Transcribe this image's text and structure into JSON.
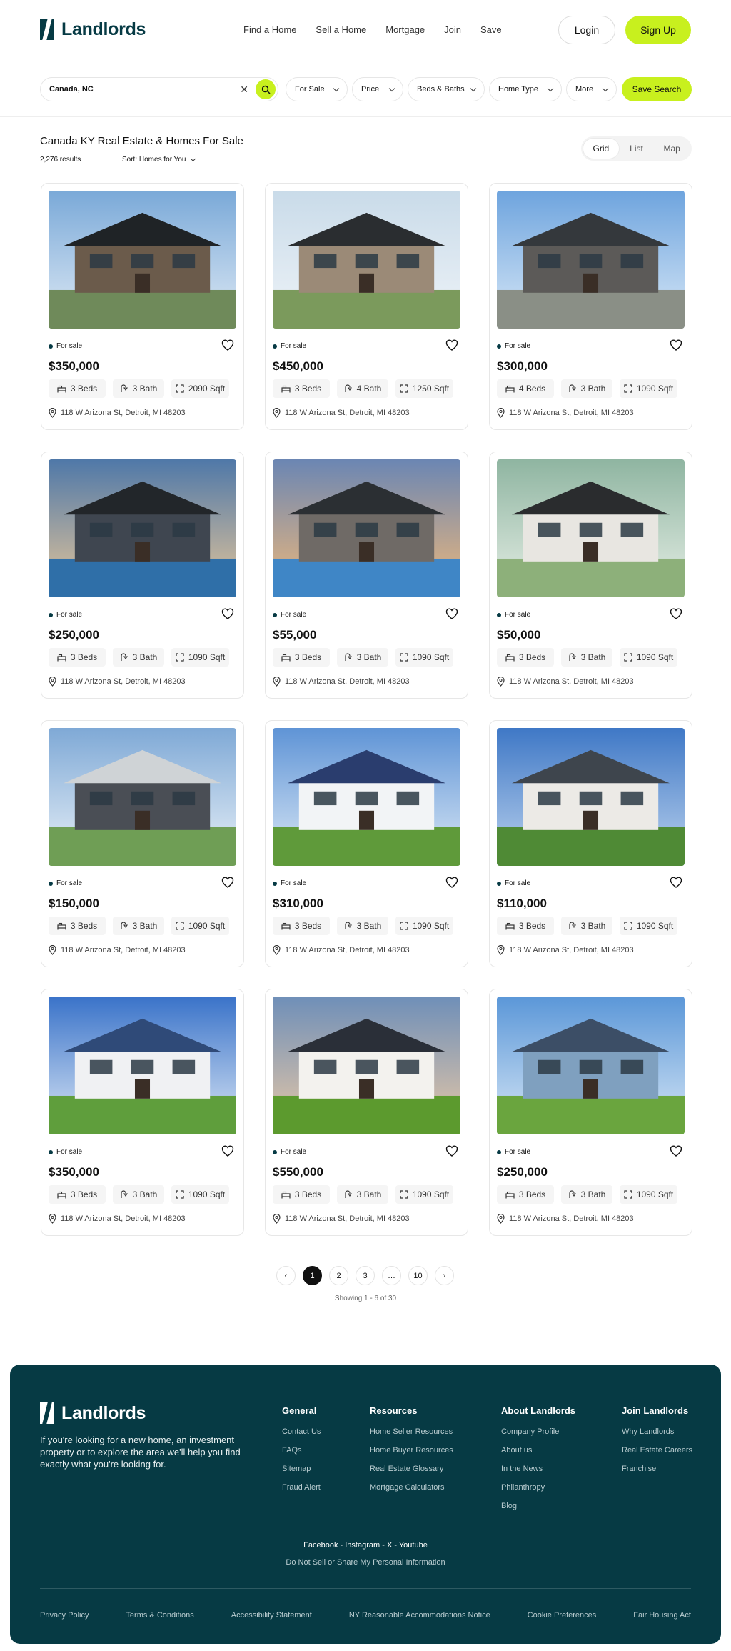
{
  "brand": {
    "name": "Landlords",
    "accent": "#c8f01e",
    "primary": "#063a44"
  },
  "nav": [
    "Find a Home",
    "Sell a Home",
    "Mortgage",
    "Join",
    "Save"
  ],
  "auth": {
    "login": "Login",
    "signup": "Sign Up"
  },
  "search": {
    "value": "Canada, NC",
    "clear_icon": "close-icon",
    "go_icon": "search-icon"
  },
  "filters": [
    "For Sale",
    "Price",
    "Beds & Baths",
    "Home Type",
    "More"
  ],
  "save_search": "Save Search",
  "results": {
    "title": "Canada KY Real Estate & Homes For Sale",
    "count": "2,276 results",
    "sort": "Sort: Homes for You"
  },
  "views": [
    "Grid",
    "List",
    "Map"
  ],
  "active_view": "Grid",
  "listings": [
    {
      "status": "For sale",
      "price": "$350,000",
      "beds": "3 Beds",
      "bath": "3 Bath",
      "sqft": "2090 Sqft",
      "address": "118 W Arizona St, Detroit, MI 48203"
    },
    {
      "status": "For sale",
      "price": "$450,000",
      "beds": "3 Beds",
      "bath": "4 Bath",
      "sqft": "1250 Sqft",
      "address": "118 W Arizona St, Detroit, MI 48203"
    },
    {
      "status": "For sale",
      "price": "$300,000",
      "beds": "4 Beds",
      "bath": "3 Bath",
      "sqft": "1090 Sqft",
      "address": "118 W Arizona St, Detroit, MI 48203"
    },
    {
      "status": "For sale",
      "price": "$250,000",
      "beds": "3 Beds",
      "bath": "3 Bath",
      "sqft": "1090 Sqft",
      "address": "118 W Arizona St, Detroit, MI 48203"
    },
    {
      "status": "For sale",
      "price": "$55,000",
      "beds": "3 Beds",
      "bath": "3 Bath",
      "sqft": "1090 Sqft",
      "address": "118 W Arizona St, Detroit, MI 48203"
    },
    {
      "status": "For sale",
      "price": "$50,000",
      "beds": "3 Beds",
      "bath": "3 Bath",
      "sqft": "1090 Sqft",
      "address": "118 W Arizona St, Detroit, MI 48203"
    },
    {
      "status": "For sale",
      "price": "$150,000",
      "beds": "3 Beds",
      "bath": "3 Bath",
      "sqft": "1090 Sqft",
      "address": "118 W Arizona St, Detroit, MI 48203"
    },
    {
      "status": "For sale",
      "price": "$310,000",
      "beds": "3 Beds",
      "bath": "3 Bath",
      "sqft": "1090 Sqft",
      "address": "118 W Arizona St, Detroit, MI 48203"
    },
    {
      "status": "For sale",
      "price": "$110,000",
      "beds": "3 Beds",
      "bath": "3 Bath",
      "sqft": "1090 Sqft",
      "address": "118 W Arizona St, Detroit, MI 48203"
    },
    {
      "status": "For sale",
      "price": "$350,000",
      "beds": "3 Beds",
      "bath": "3 Bath",
      "sqft": "1090 Sqft",
      "address": "118 W Arizona St, Detroit, MI 48203"
    },
    {
      "status": "For sale",
      "price": "$550,000",
      "beds": "3 Beds",
      "bath": "3 Bath",
      "sqft": "1090 Sqft",
      "address": "118 W Arizona St, Detroit, MI 48203"
    },
    {
      "status": "For sale",
      "price": "$250,000",
      "beds": "3 Beds",
      "bath": "3 Bath",
      "sqft": "1090 Sqft",
      "address": "118 W Arizona St, Detroit, MI 48203"
    }
  ],
  "pagination": {
    "pages": [
      "1",
      "2",
      "3",
      "…",
      "10"
    ],
    "current": "1",
    "prev_icon": "chevron-left-icon",
    "next_icon": "chevron-right-icon",
    "showing": "Showing 1 - 6 of 30"
  },
  "footer": {
    "about": "If you're looking for a new home, an investment property or to explore the area we'll help you find exactly what you're looking for.",
    "columns": [
      {
        "title": "General",
        "links": [
          "Contact Us",
          "FAQs",
          "Sitemap",
          "Fraud Alert"
        ]
      },
      {
        "title": "Resources",
        "links": [
          "Home Seller Resources",
          "Home Buyer Resources",
          "Real Estate Glossary",
          "Mortgage Calculators"
        ]
      },
      {
        "title": "About Landlords",
        "links": [
          "Company Profile",
          "About us",
          "In the News",
          "Philanthropy",
          "Blog"
        ]
      },
      {
        "title": "Join Landlords",
        "links": [
          "Why Landlords",
          "Real Estate Careers",
          "Franchise"
        ]
      }
    ],
    "social": "Facebook - Instagram - X - Youtube",
    "dns": "Do Not Sell or Share My Personal Information",
    "legal": [
      "Privacy Policy",
      "Terms & Conditions",
      "Accessibility Statement",
      "NY Reasonable Accommodations Notice",
      "Cookie Preferences",
      "Fair Housing Act"
    ]
  }
}
